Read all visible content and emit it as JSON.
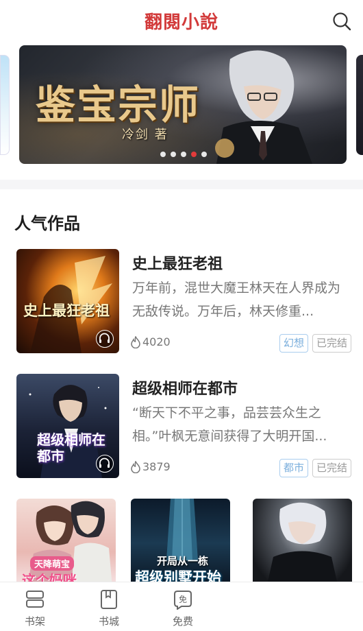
{
  "header": {
    "app_title": "翻閱小說",
    "search_icon": "search-icon"
  },
  "banner": {
    "title": "鉴宝宗师",
    "author": "冷剑 著",
    "slide_count": 5,
    "active_slide": 4
  },
  "popular": {
    "section_title": "人气作品",
    "books": [
      {
        "cover_text": "史上最狂老祖",
        "title": "史上最狂老祖",
        "description": "万年前，混世大魔王林天在人界成为无敌传说。万年后，林天修重...",
        "heat": "4020",
        "tags": [
          "幻想",
          "已完结"
        ],
        "has_audio": true
      },
      {
        "cover_text": "超级相师在都市",
        "title": "超级相师在都市",
        "description": "“断天下不平之事，品芸芸众生之相。”叶枫无意间获得了大明开国...",
        "heat": "3879",
        "tags": [
          "都市",
          "已完结"
        ],
        "has_audio": true
      }
    ],
    "grid": [
      {
        "cover_text": "这个妈咪",
        "top_text": "天降萌宝"
      },
      {
        "cover_text": "超级别墅开始",
        "top_text": "开局从一栋"
      },
      {
        "cover_text": "",
        "top_text": ""
      }
    ]
  },
  "tabbar": {
    "items": [
      {
        "label": "书架",
        "icon": "bookshelf-icon"
      },
      {
        "label": "书城",
        "icon": "bookstore-icon"
      },
      {
        "label": "免费",
        "icon": "free-icon"
      }
    ]
  },
  "colors": {
    "brand": "#d23a3a",
    "active_dot": "#e33b3b",
    "genre_tag": "#7aaedc",
    "status_tag": "#999999"
  }
}
